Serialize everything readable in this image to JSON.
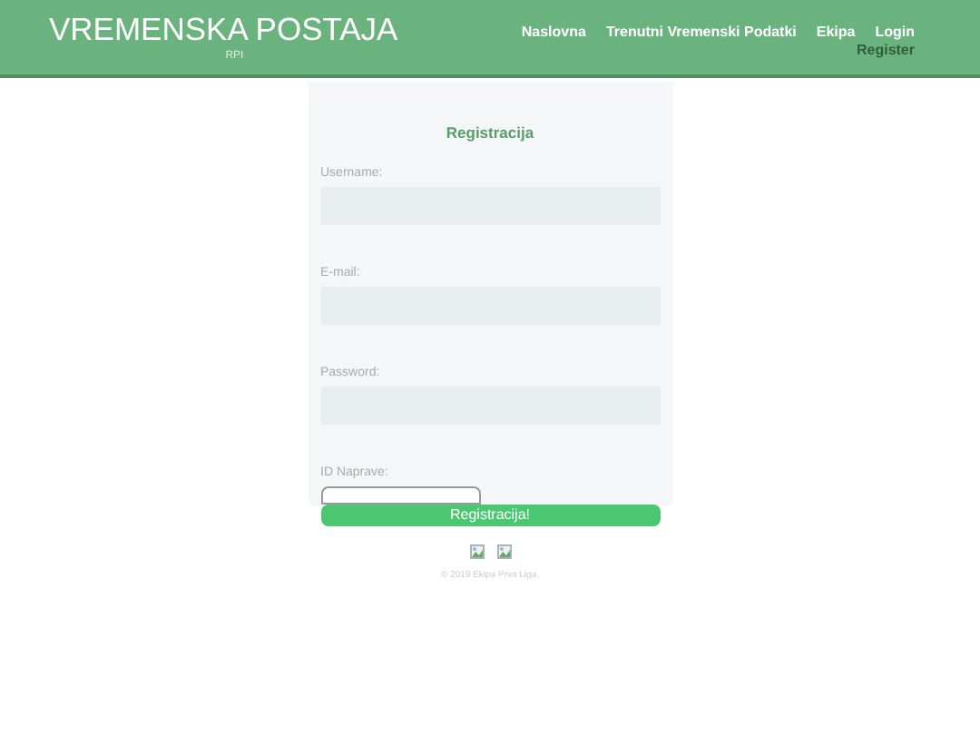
{
  "header": {
    "title": "VREMENSKA POSTAJA",
    "subtitle": "RPI"
  },
  "nav": [
    {
      "label": "Naslovna",
      "selected": false
    },
    {
      "label": "Trenutni Vremenski Podatki",
      "selected": false
    },
    {
      "label": "Ekipa",
      "selected": false
    },
    {
      "label": "Login",
      "selected": false
    },
    {
      "label": "Register",
      "selected": true
    }
  ],
  "form": {
    "title": "Registracija",
    "fields": [
      {
        "label": "Username:",
        "kind": "wide"
      },
      {
        "label": "E-mail:",
        "kind": "wide"
      },
      {
        "label": "Password:",
        "kind": "wide"
      },
      {
        "label": "ID Naprave:",
        "kind": "small"
      }
    ],
    "submit": "Registracija!"
  },
  "footer": {
    "copyright": "© 2019 Ekipa Prva Liga."
  }
}
